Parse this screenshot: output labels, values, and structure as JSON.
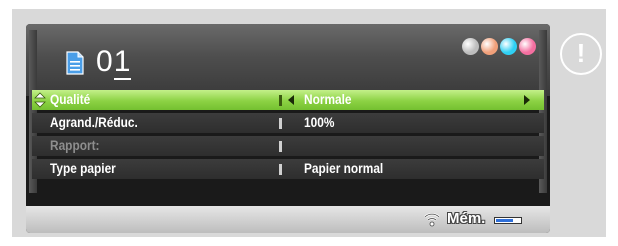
{
  "header": {
    "copies_prefix": "0",
    "copies_underlined": "1"
  },
  "ink_colors": [
    "#bdbdbd",
    "#f1a07a",
    "#2fd0f4",
    "#f46fa0"
  ],
  "rows": [
    {
      "label": "Qualité",
      "value": "Normale"
    },
    {
      "label": "Agrand./Réduc.",
      "value": "100%"
    },
    {
      "label": "Rapport:",
      "value": ""
    },
    {
      "label": "Type papier",
      "value": "Papier normal"
    }
  ],
  "status": {
    "memory_label": "Mém.",
    "memory_level": 0.7
  },
  "alert_symbol": "!",
  "colors": {
    "selected_row": "#8cd244",
    "status_bar": "#d0d0d0",
    "memory_fill": "#2f6fd8"
  }
}
